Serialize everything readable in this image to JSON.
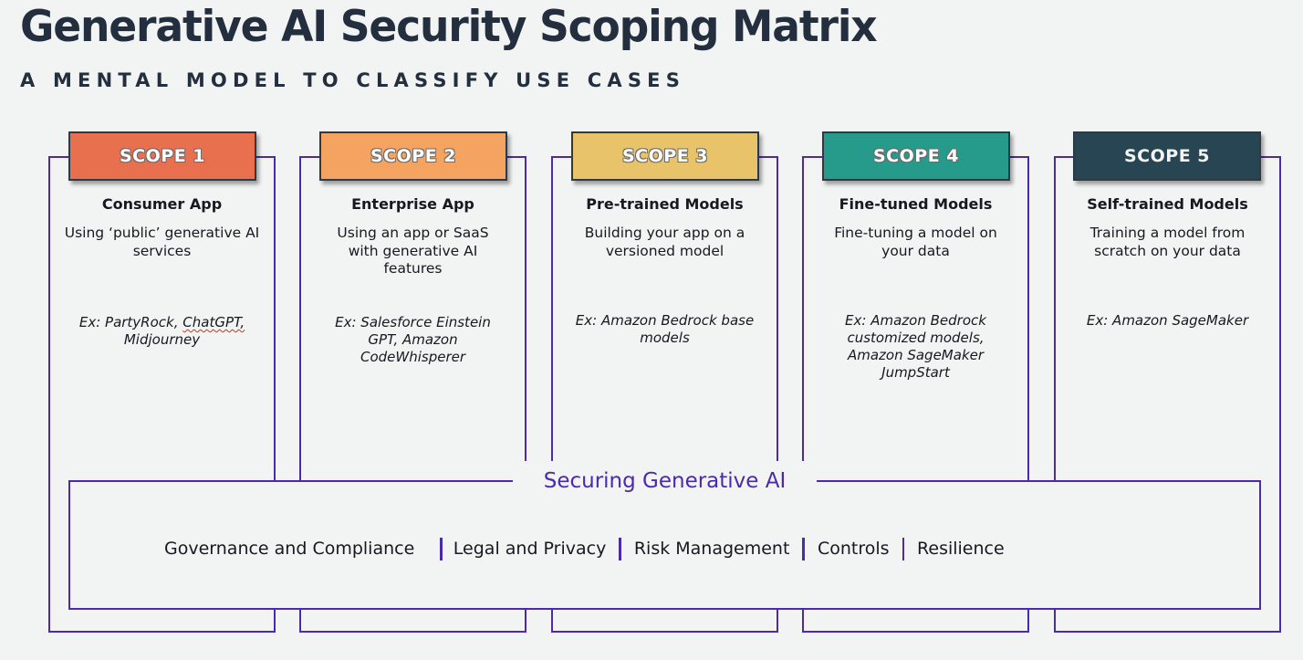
{
  "header": {
    "title": "Generative AI Security Scoping Matrix",
    "subtitle": "A MENTAL MODEL TO CLASSIFY USE CASES"
  },
  "colors": {
    "background": "#f2f3f3",
    "title": "#232f3e",
    "outline": "#4b2aad"
  },
  "scopes": [
    {
      "label": "SCOPE 1",
      "color": "#e9704f",
      "title": "Consumer App",
      "description": "Using ‘public’ generative AI services",
      "example_prefix": "Ex: PartyRock, ",
      "example_flagged": "ChatGPT,",
      "example_suffix": " Midjourney"
    },
    {
      "label": "SCOPE 2",
      "color": "#f4a460",
      "title": "Enterprise App",
      "description": "Using an app or SaaS with generative AI features",
      "example": "Ex: Salesforce Einstein GPT, Amazon CodeWhisperer"
    },
    {
      "label": "SCOPE 3",
      "color": "#e8c36a",
      "title": "Pre-trained Models",
      "description": "Building your app on a versioned model",
      "example": "Ex: Amazon Bedrock base models"
    },
    {
      "label": "SCOPE 4",
      "color": "#269b8c",
      "title": "Fine-tuned Models",
      "description": "Fine-tuning a model on your data",
      "example": "Ex: Amazon Bedrock customized models, Amazon SageMaker JumpStart"
    },
    {
      "label": "SCOPE 5",
      "color": "#284554",
      "title": "Self-trained Models",
      "description": "Training a model from scratch on your data",
      "example": "Ex: Amazon SageMaker"
    }
  ],
  "securing": {
    "label": "Securing Generative AI",
    "pillars": [
      "Governance and Compliance",
      "Legal and Privacy",
      "Risk Management",
      "Controls",
      "Resilience"
    ]
  }
}
